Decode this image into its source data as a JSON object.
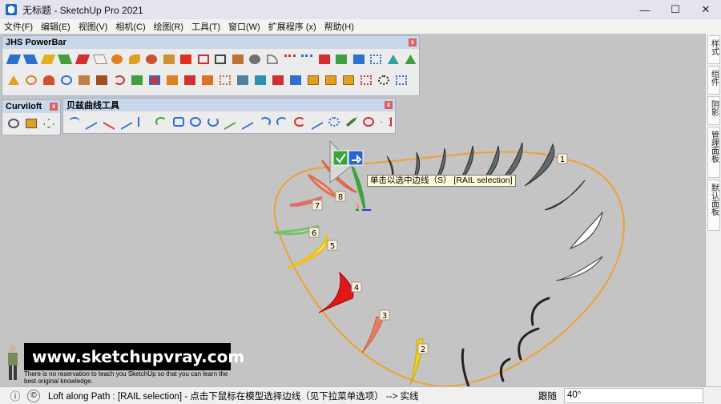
{
  "window": {
    "title": "无标题 - SketchUp Pro 2021",
    "controls": [
      "—",
      "☐",
      "✕"
    ]
  },
  "menu": [
    "文件(F)",
    "编辑(E)",
    "视图(V)",
    "相机(C)",
    "绘图(R)",
    "工具(T)",
    "窗口(W)",
    "扩展程序 (x)",
    "帮助(H)"
  ],
  "panels": {
    "powerbar": {
      "title": "JHS PowerBar",
      "close": "x"
    },
    "curviloft": {
      "title": "Curviloft",
      "close": "x"
    },
    "bezier": {
      "title": "贝兹曲线工具",
      "close": "x"
    }
  },
  "tray_tabs": [
    "样式",
    "组件",
    "阴影",
    "管理面板",
    "默认面板"
  ],
  "tooltip": "单击以选中边线（S）  [RAIL selection]",
  "markers": [
    "1",
    "2",
    "3",
    "4",
    "5",
    "6",
    "7",
    "8"
  ],
  "watermark": {
    "url": "www.sketchupvray.com",
    "tagline": "There is no reservation to teach you SketchUp so that you can learn the best original knowledge."
  },
  "status": {
    "text": "Loft along Path : [RAIL selection] - 点击下鼠标在模型选择边线（见下拉菜单选项） --> 实线",
    "measure_label": "跟随",
    "measure_value": "40°"
  },
  "colors": {
    "rail": "#f0a030",
    "accent_green": "#37a537",
    "accent_blue": "#2a64d0",
    "powerbar_head": "#c9d7ea"
  }
}
